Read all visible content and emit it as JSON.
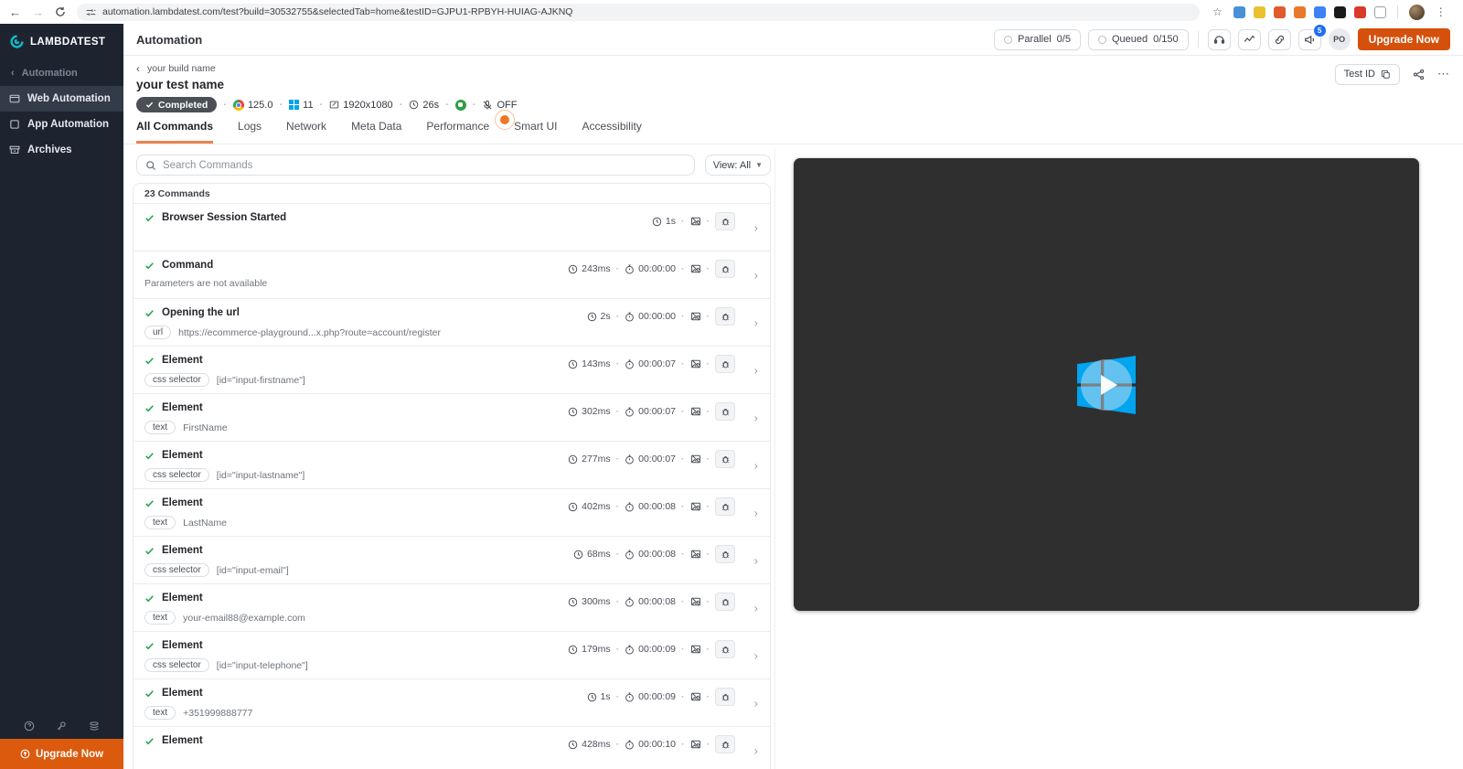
{
  "browser": {
    "url": "automation.lambdatest.com/test?build=30532755&selectedTab=home&testID=GJPU1-RPBYH-HUIAG-AJKNQ",
    "extensions": [
      {
        "name": "extension-blue",
        "color": "#4a90d9"
      },
      {
        "name": "extension-yellow-js",
        "color": "#e8c231"
      },
      {
        "name": "extension-orange-text",
        "color": "#e05a2b"
      },
      {
        "name": "extension-fox",
        "color": "#e8792b"
      },
      {
        "name": "extension-blue-arc",
        "color": "#3b82f6"
      },
      {
        "name": "extension-dark-g",
        "color": "#1a1a1a"
      },
      {
        "name": "extension-red-circle",
        "color": "#d93a2b"
      },
      {
        "name": "extension-puzzle",
        "color": "#ffffff"
      }
    ]
  },
  "sidebar": {
    "brand": "LAMBDATEST",
    "section_label": "Automation",
    "items": [
      {
        "label": "Web Automation",
        "active": true
      },
      {
        "label": "App Automation",
        "active": false
      },
      {
        "label": "Archives",
        "active": false
      }
    ],
    "upgrade_label": "Upgrade Now"
  },
  "header": {
    "title": "Automation",
    "parallel_label": "Parallel",
    "parallel_value": "0/5",
    "queued_label": "Queued",
    "queued_value": "0/150",
    "notification_count": "5",
    "avatar_initials": "PO",
    "upgrade_button": "Upgrade Now"
  },
  "test": {
    "breadcrumb": "your build name",
    "name": "your test name",
    "status": "Completed",
    "browser_version": "125.0",
    "os_version": "11",
    "resolution": "1920x1080",
    "duration": "26s",
    "audio_state": "OFF",
    "test_id_button": "Test ID"
  },
  "tabs": [
    {
      "label": "All Commands",
      "active": true
    },
    {
      "label": "Logs",
      "active": false
    },
    {
      "label": "Network",
      "active": false
    },
    {
      "label": "Meta Data",
      "active": false
    },
    {
      "label": "Performance",
      "active": false
    },
    {
      "label": "Smart UI",
      "active": false
    },
    {
      "label": "Accessibility",
      "active": false
    }
  ],
  "commands": {
    "search_placeholder": "Search Commands",
    "view_filter": "View: All",
    "count_label": "23 Commands",
    "rows": [
      {
        "name": "Browser Session Started",
        "duration": "1s",
        "video_time": "",
        "param_type": "",
        "param_value": "",
        "note": ""
      },
      {
        "name": "Command",
        "duration": "243ms",
        "video_time": "00:00:00",
        "param_type": "",
        "param_value": "",
        "note": "Parameters are not available"
      },
      {
        "name": "Opening the url",
        "duration": "2s",
        "video_time": "00:00:00",
        "param_type": "url",
        "param_value": "https://ecommerce-playground...x.php?route=account/register",
        "note": ""
      },
      {
        "name": "Element",
        "duration": "143ms",
        "video_time": "00:00:07",
        "param_type": "css selector",
        "param_value": "[id=\"input-firstname\"]",
        "note": ""
      },
      {
        "name": "Element",
        "duration": "302ms",
        "video_time": "00:00:07",
        "param_type": "text",
        "param_value": "FirstName",
        "note": ""
      },
      {
        "name": "Element",
        "duration": "277ms",
        "video_time": "00:00:07",
        "param_type": "css selector",
        "param_value": "[id=\"input-lastname\"]",
        "note": ""
      },
      {
        "name": "Element",
        "duration": "402ms",
        "video_time": "00:00:08",
        "param_type": "text",
        "param_value": "LastName",
        "note": ""
      },
      {
        "name": "Element",
        "duration": "68ms",
        "video_time": "00:00:08",
        "param_type": "css selector",
        "param_value": "[id=\"input-email\"]",
        "note": ""
      },
      {
        "name": "Element",
        "duration": "300ms",
        "video_time": "00:00:08",
        "param_type": "text",
        "param_value": "your-email88@example.com",
        "note": ""
      },
      {
        "name": "Element",
        "duration": "179ms",
        "video_time": "00:00:09",
        "param_type": "css selector",
        "param_value": "[id=\"input-telephone\"]",
        "note": ""
      },
      {
        "name": "Element",
        "duration": "1s",
        "video_time": "00:00:09",
        "param_type": "text",
        "param_value": "+351999888777",
        "note": ""
      },
      {
        "name": "Element",
        "duration": "428ms",
        "video_time": "00:00:10",
        "param_type": "",
        "param_value": "",
        "note": ""
      }
    ]
  },
  "colors": {
    "accent_orange": "#d4500b",
    "brand_teal": "#0ebac5",
    "success_green": "#22a14b",
    "sidebar_dark": "#1d2430",
    "windows_blue": "#00a4ef"
  }
}
